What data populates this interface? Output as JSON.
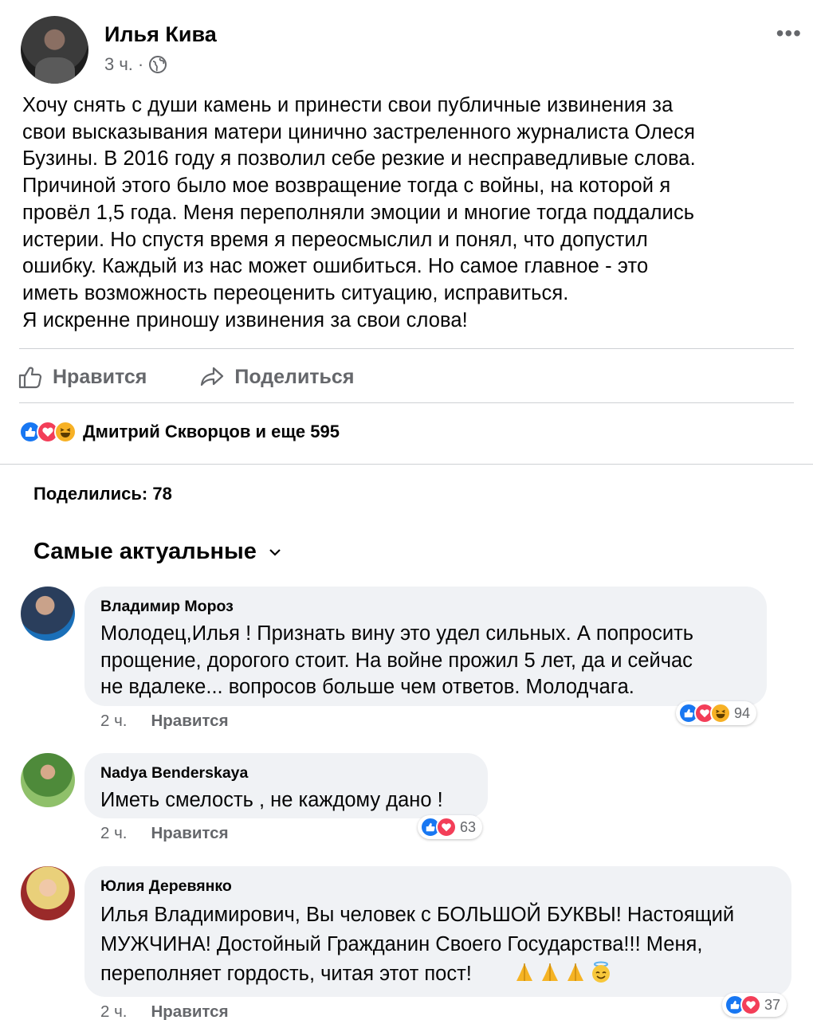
{
  "post": {
    "author": "Илья Кива",
    "time": "3 ч.",
    "separator": "·",
    "more_label": "•••",
    "text": "Хочу снять с души камень и принести свои публичные извинения за\nсвои высказывания матери цинично застреленного журналиста Олеся\nБузины. В 2016 году я позволил себе резкие и несправедливые слова.\nПричиной этого было мое возвращение тогда с войны, на которой я\nпровёл 1,5 года. Меня переполняли эмоции и многие тогда поддались\nистерии. Но спустя время я переосмыслил и понял, что допустил\nошибку. Каждый из нас может ошибиться. Но самое главное - это\nиметь возможность переоценить ситуацию, исправиться.\nЯ искренне приношу извинения за свои слова!",
    "like_label": "Нравится",
    "share_label": "Поделиться",
    "reactors": "Дмитрий Скворцов и еще 595",
    "shares": "Поделились: 78",
    "sort_label": "Самые актуальные"
  },
  "comments": [
    {
      "name": "Владимир Мороз",
      "text": "Молодец,Илья ! Признать вину это удел сильных.  А попросить\nпрощение, дорогого стоит. На войне прожил 5 лет, да и сейчас\nне вдалеке... вопросов больше чем ответов. Молодчага.",
      "time": "2 ч.",
      "like_label": "Нравится",
      "reaction_count": "94"
    },
    {
      "name": "Nadya Benderskaya",
      "text": "Иметь смелость , не каждому дано !",
      "time": "2 ч.",
      "like_label": "Нравится",
      "reaction_count": "63"
    },
    {
      "name": "Юлия Деревянко",
      "text": "Илья Владимирович, Вы человек с БОЛЬШОЙ БУКВЫ! Настоящий\nМУЖЧИНА! Достойный Гражданин Своего Государства!!! Меня,\nпереполняет гордость, читая этот пост!",
      "time": "2 ч.",
      "like_label": "Нравится",
      "reaction_count": "37"
    }
  ],
  "colors": {
    "primary_text": "#050505",
    "secondary_text": "#65676b",
    "bubble_bg": "#f0f2f5",
    "like_blue": "#1877f2",
    "love_red": "#f33e58",
    "haha_yellow": "#f7b125"
  },
  "icons": [
    "globe-icon",
    "more-icon",
    "like-icon",
    "share-icon",
    "chevron-down-icon",
    "like-reaction-icon",
    "love-reaction-icon",
    "haha-reaction-icon",
    "pray-emoji-icon",
    "smiling-halo-emoji-icon"
  ]
}
